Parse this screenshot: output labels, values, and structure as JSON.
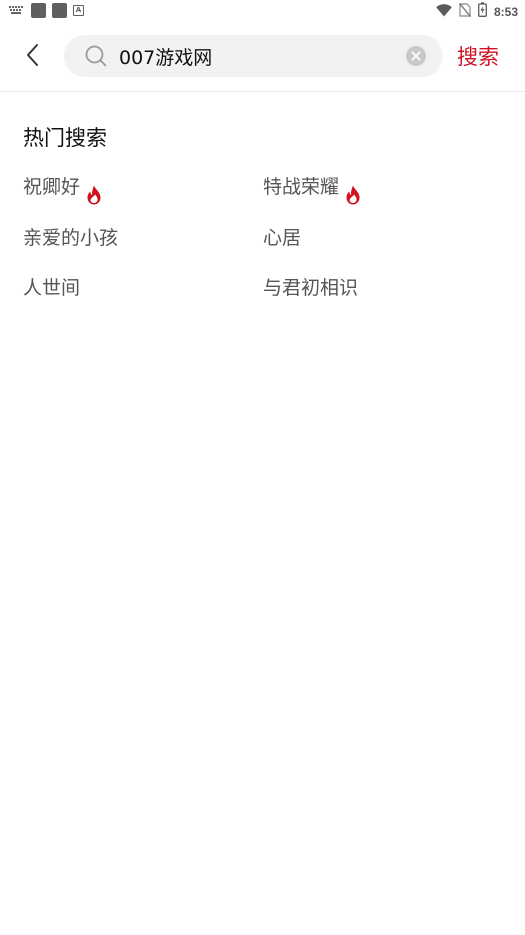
{
  "status_bar": {
    "time": "8:53",
    "left_icons": [
      "keyboard-icon",
      "app-square-icon",
      "app-square-icon",
      "text-a-icon"
    ],
    "right_icons": [
      "wifi-icon",
      "no-sim-icon",
      "battery-charging-icon"
    ]
  },
  "header": {
    "back_icon": "chevron-left-icon",
    "search": {
      "value": "007游戏网",
      "icon": "search-icon",
      "clear_icon": "clear-circle-icon"
    },
    "search_button_label": "搜索"
  },
  "hot_search": {
    "title": "热门搜索",
    "items": [
      {
        "label": "祝卿好",
        "hot": true
      },
      {
        "label": "特战荣耀",
        "hot": true
      },
      {
        "label": "亲爱的小孩",
        "hot": false
      },
      {
        "label": "心居",
        "hot": false
      },
      {
        "label": "人世间",
        "hot": false
      },
      {
        "label": "与君初相识",
        "hot": false
      }
    ]
  },
  "colors": {
    "accent": "#cf1126",
    "search_bg": "#f2f2f2",
    "item_text": "#555555",
    "title_text": "#111111"
  }
}
